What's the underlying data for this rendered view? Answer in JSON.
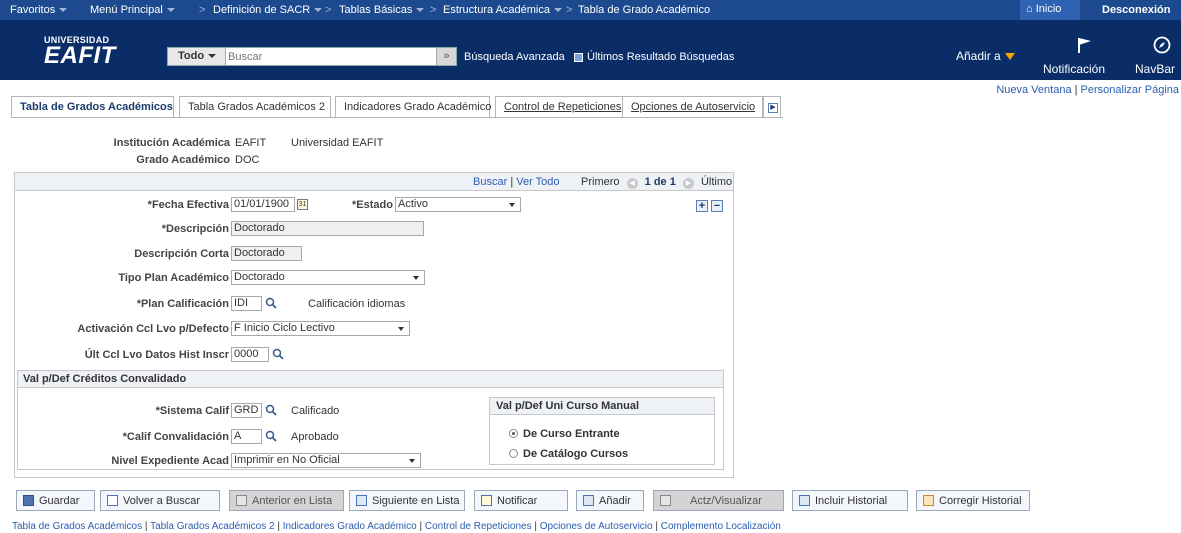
{
  "topnav": {
    "favoritos": "Favoritos",
    "menu": "Menú Principal",
    "crumbs": [
      "Definición de SACR",
      "Tablas Básicas",
      "Estructura Académica",
      "Tabla de Grado Académico"
    ],
    "inicio": "Inicio",
    "desconexion": "Desconexión"
  },
  "header": {
    "logo_top": "UNIVERSIDAD",
    "logo_main": "EAFIT",
    "search_scope": "Todo",
    "search_placeholder": "Buscar",
    "busqueda_avanzada": "Búsqueda Avanzada",
    "ultimos": "Últimos Resultado Búsquedas",
    "aniadir": "Añadir a",
    "notificacion": "Notificación",
    "navbar": "NavBar"
  },
  "page_links": {
    "nueva_ventana": "Nueva Ventana",
    "personalizar": "Personalizar Página"
  },
  "tabs": [
    "Tabla de Grados Académicos",
    "Tabla Grados Académicos 2",
    "Indicadores Grado Académico",
    "Control de Repeticiones",
    "Opciones de Autoservicio"
  ],
  "header_info": {
    "inst_label": "Institución Académica",
    "inst_code": "EAFIT",
    "inst_name": "Universidad EAFIT",
    "grado_label": "Grado Académico",
    "grado_code": "DOC"
  },
  "grid_nav": {
    "buscar": "Buscar",
    "ver_todo": "Ver Todo",
    "primero": "Primero",
    "count": "1 de 1",
    "ultimo": "Último"
  },
  "form": {
    "fecha_label": "*Fecha Efectiva",
    "fecha_value": "01/01/1900",
    "estado_label": "*Estado",
    "estado_value": "Activo",
    "descripcion_label": "*Descripción",
    "descripcion_value": "Doctorado",
    "desc_corta_label": "Descripción Corta",
    "desc_corta_value": "Doctorado",
    "tipo_plan_label": "Tipo Plan Académico",
    "tipo_plan_value": "Doctorado",
    "plan_calif_label": "*Plan Calificación",
    "plan_calif_value": "IDI",
    "plan_calif_desc": "Calificación idiomas",
    "activacion_label": "Activación Ccl Lvo p/Defecto",
    "activacion_value": "F Inicio Ciclo Lectivo",
    "ult_label": "Últ Ccl Lvo Datos Hist Inscr",
    "ult_value": "0000"
  },
  "convalidado": {
    "title": "Val p/Def Créditos Convalidado",
    "sistema_label": "*Sistema Calif",
    "sistema_value": "GRD",
    "sistema_desc": "Calificado",
    "calif_label": "*Calif Convalidación",
    "calif_value": "A",
    "calif_desc": "Aprobado",
    "nivel_label": "Nivel Expediente Acad",
    "nivel_value": "Imprimir en No Oficial",
    "uni_title": "Val p/Def Uni Curso Manual",
    "radio1": "De Curso Entrante",
    "radio2": "De Catálogo Cursos"
  },
  "buttons": {
    "guardar": "Guardar",
    "volver": "Volver a Buscar",
    "anterior": "Anterior en Lista",
    "siguiente": "Siguiente en Lista",
    "notificar": "Notificar",
    "aniadir": "Añadir",
    "actz": "Actz/Visualizar",
    "incluir": "Incluir Historial",
    "corregir": "Corregir Historial"
  },
  "footer_links": [
    "Tabla de Grados Académicos",
    "Tabla Grados Académicos 2",
    "Indicadores Grado Académico",
    "Control de Repeticiones",
    "Opciones de Autoservicio",
    "Complemento Localización"
  ]
}
